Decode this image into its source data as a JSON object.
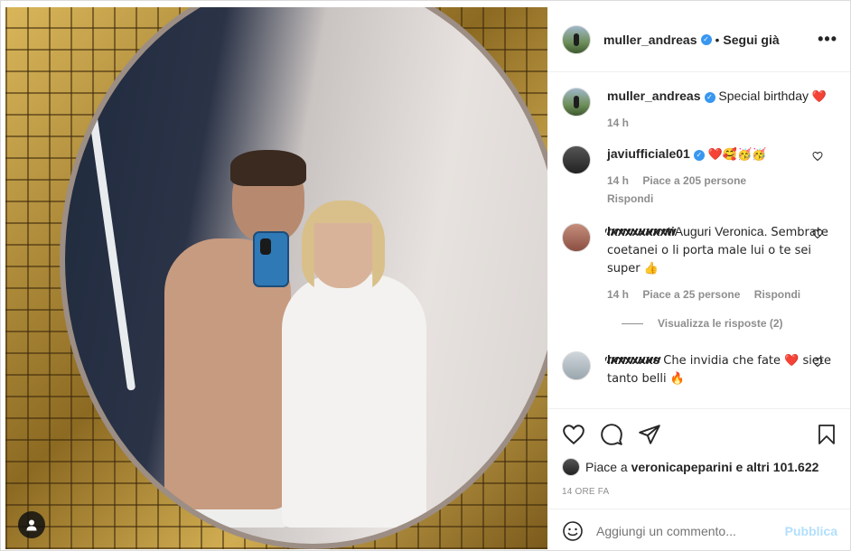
{
  "post": {
    "author": "muller_andreas",
    "verified": true,
    "follow_state": "Segui già",
    "more_icon": "more-horizontal-icon",
    "dot": "•"
  },
  "caption": {
    "author": "muller_andreas",
    "text": "Special birthday",
    "emoji": "❤️",
    "time": "14 h"
  },
  "comments": [
    {
      "author": "javiufficiale01",
      "verified": true,
      "text": "❤️🥰🥳🥳",
      "time": "14 h",
      "likes": "Piace a 205 persone",
      "reply": "Rispondi"
    },
    {
      "author": "lxxxxxxxxti",
      "text_line1": "Auguri Veronica.",
      "text_rest": "Sembrate coetanei o li porta male lui o te sei super 👍",
      "time": "14 h",
      "likes": "Piace a 25 persone",
      "reply": "Rispondi",
      "view_replies": "Visualizza le risposte (2)"
    },
    {
      "author": "lxxxxxxs",
      "text": "Che invidia che fate ❤️ siete tanto belli 🔥"
    }
  ],
  "likes_summary": {
    "prefix": "Piace a",
    "user": "veronicapeparini",
    "suffix": "e altri",
    "count": "101.622"
  },
  "timestamp": "14 ORE FA",
  "composer": {
    "placeholder": "Aggiungi un commento...",
    "post_label": "Pubblica"
  },
  "colors": {
    "verified": "#3897f0",
    "heart": "#ed4956",
    "post_disabled": "#b2dffc",
    "muted": "#8e8e8e"
  }
}
